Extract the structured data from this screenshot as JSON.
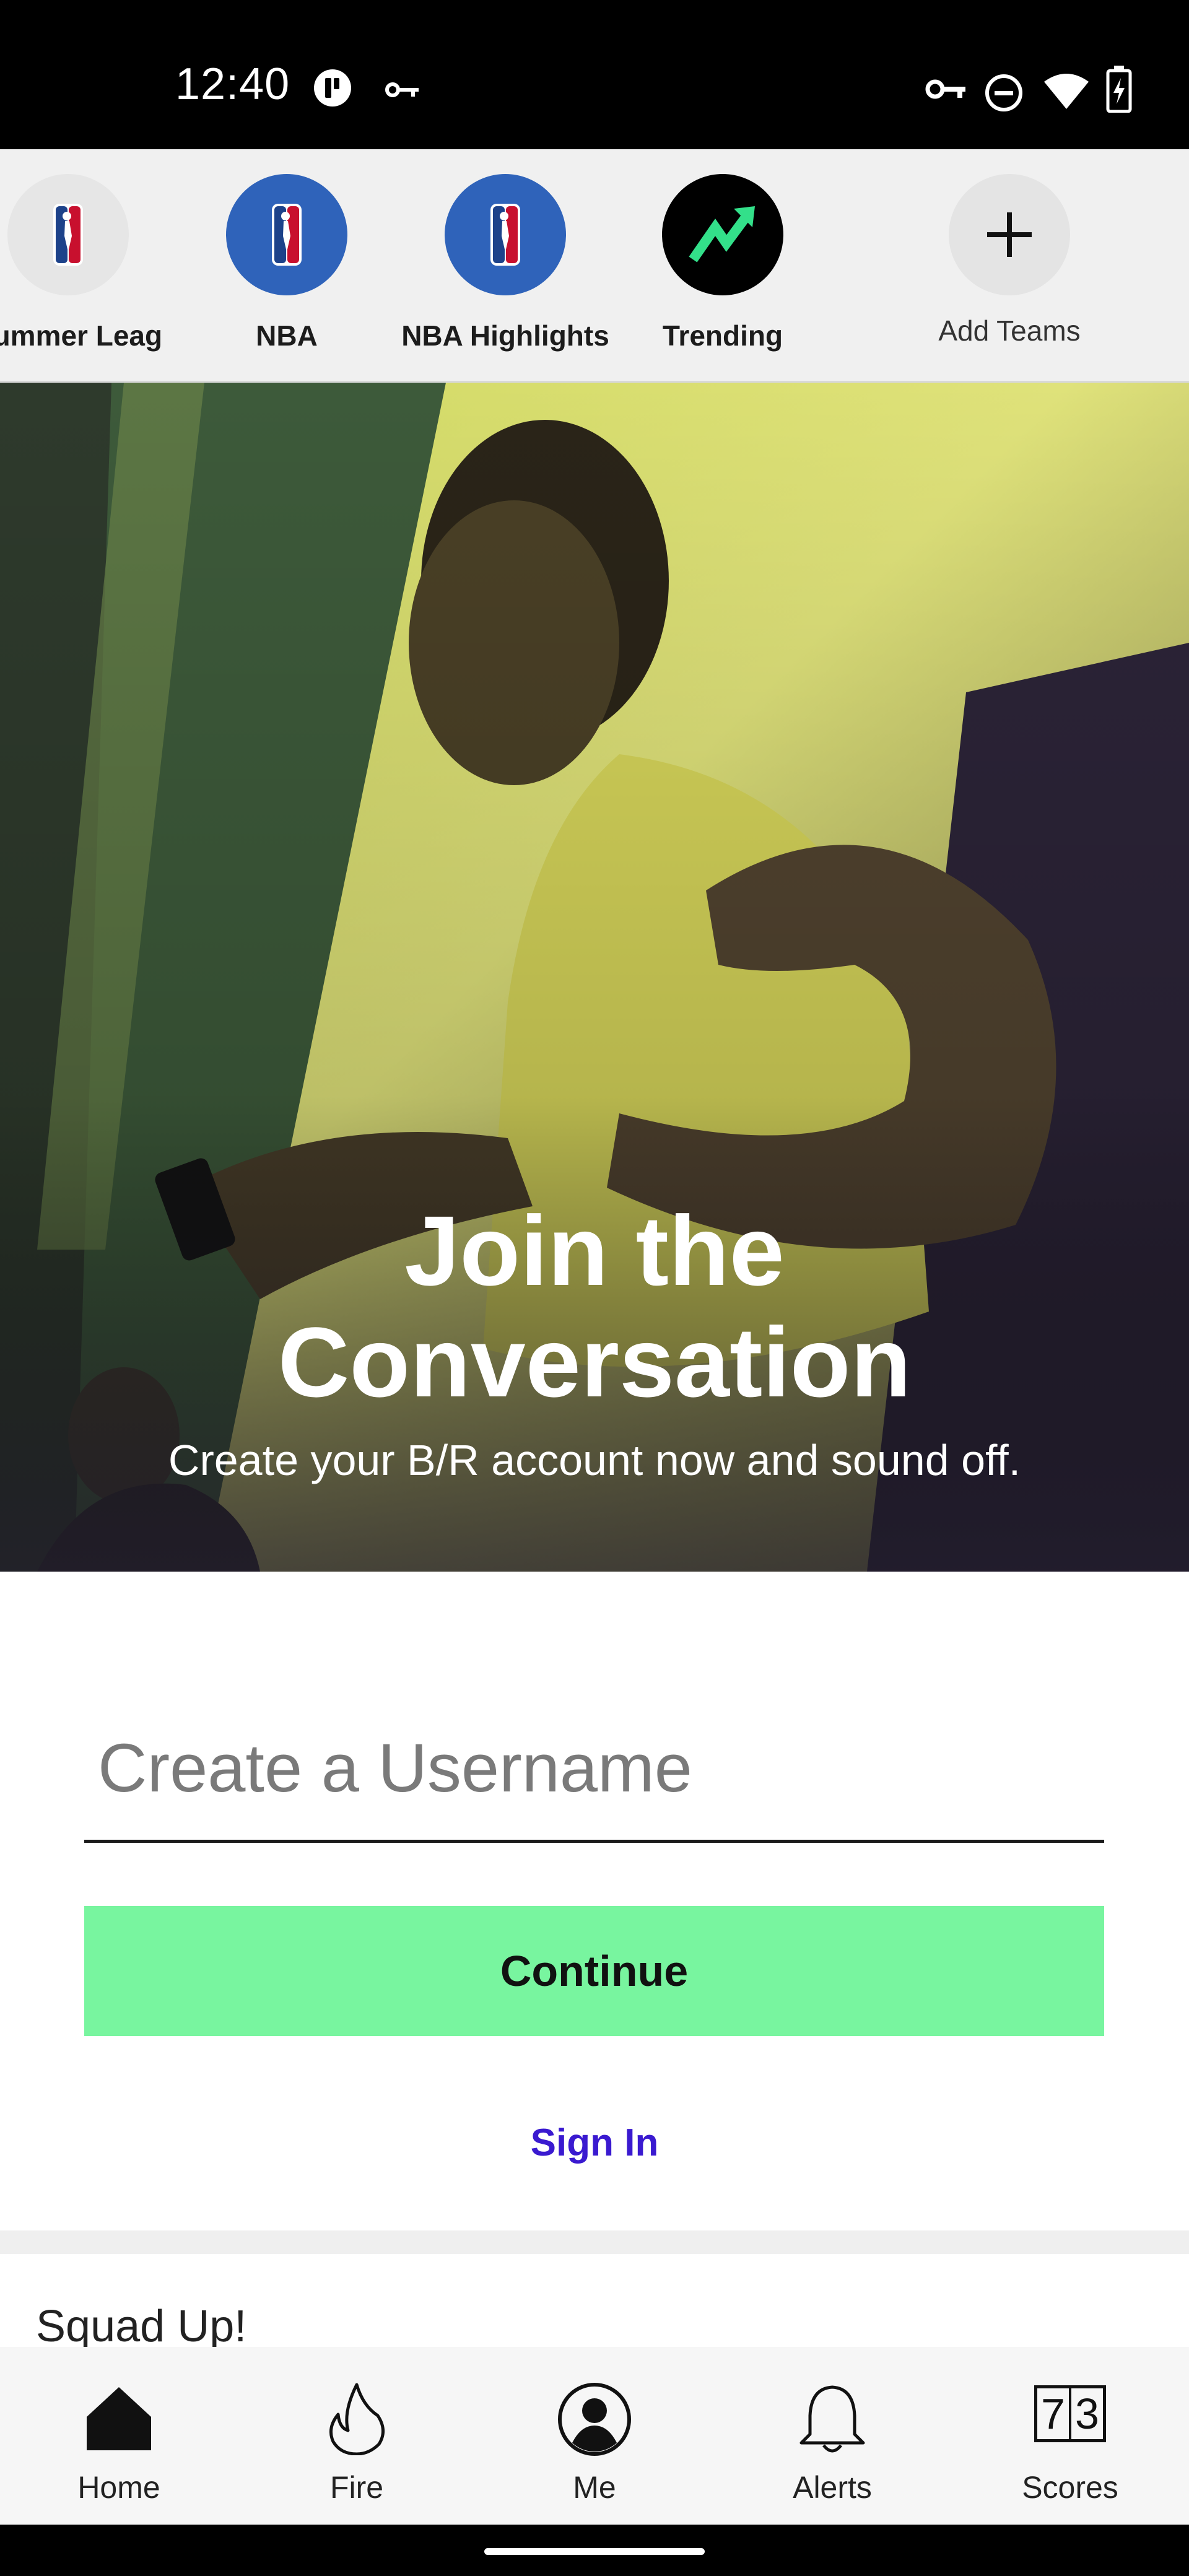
{
  "status_bar": {
    "time": "12:40",
    "icons": [
      "app-notification-icon",
      "vpn-key-icon",
      "key-icon",
      "do-not-disturb-icon",
      "wifi-icon",
      "battery-charging-icon"
    ]
  },
  "teams": [
    {
      "label": "Summer Leag",
      "icon": "nba-logo-icon",
      "circle_color": "#e6e6e6"
    },
    {
      "label": "NBA",
      "icon": "nba-logo-icon",
      "circle_color": "#2f63ba"
    },
    {
      "label": "NBA Highlights",
      "icon": "nba-logo-icon",
      "circle_color": "#2f63ba"
    },
    {
      "label": "Trending",
      "icon": "trending-arrow-icon",
      "circle_color": "#000000"
    },
    {
      "label": "Add Teams",
      "icon": "plus-icon",
      "circle_color": "#e4e4e4"
    }
  ],
  "hero": {
    "title_line1": "Join the",
    "title_line2": "Conversation",
    "subtitle": "Create your B/R account now and sound off."
  },
  "form": {
    "username_placeholder": "Create a Username",
    "username_value": "",
    "continue_label": "Continue",
    "signin_label": "Sign In"
  },
  "section_title": "Squad Up!",
  "bottom_nav": [
    {
      "label": "Home",
      "icon": "home-icon",
      "active": true
    },
    {
      "label": "Fire",
      "icon": "fire-icon",
      "active": false
    },
    {
      "label": "Me",
      "icon": "profile-icon",
      "active": false
    },
    {
      "label": "Alerts",
      "icon": "bell-icon",
      "active": false
    },
    {
      "label": "Scores",
      "icon": "scores-icon",
      "active": false,
      "digits": [
        "7",
        "3"
      ]
    }
  ],
  "colors": {
    "accent_green": "#78f59f",
    "link_purple": "#3a1ad0",
    "nba_blue": "#2f63ba",
    "trending_green": "#33e08a"
  }
}
